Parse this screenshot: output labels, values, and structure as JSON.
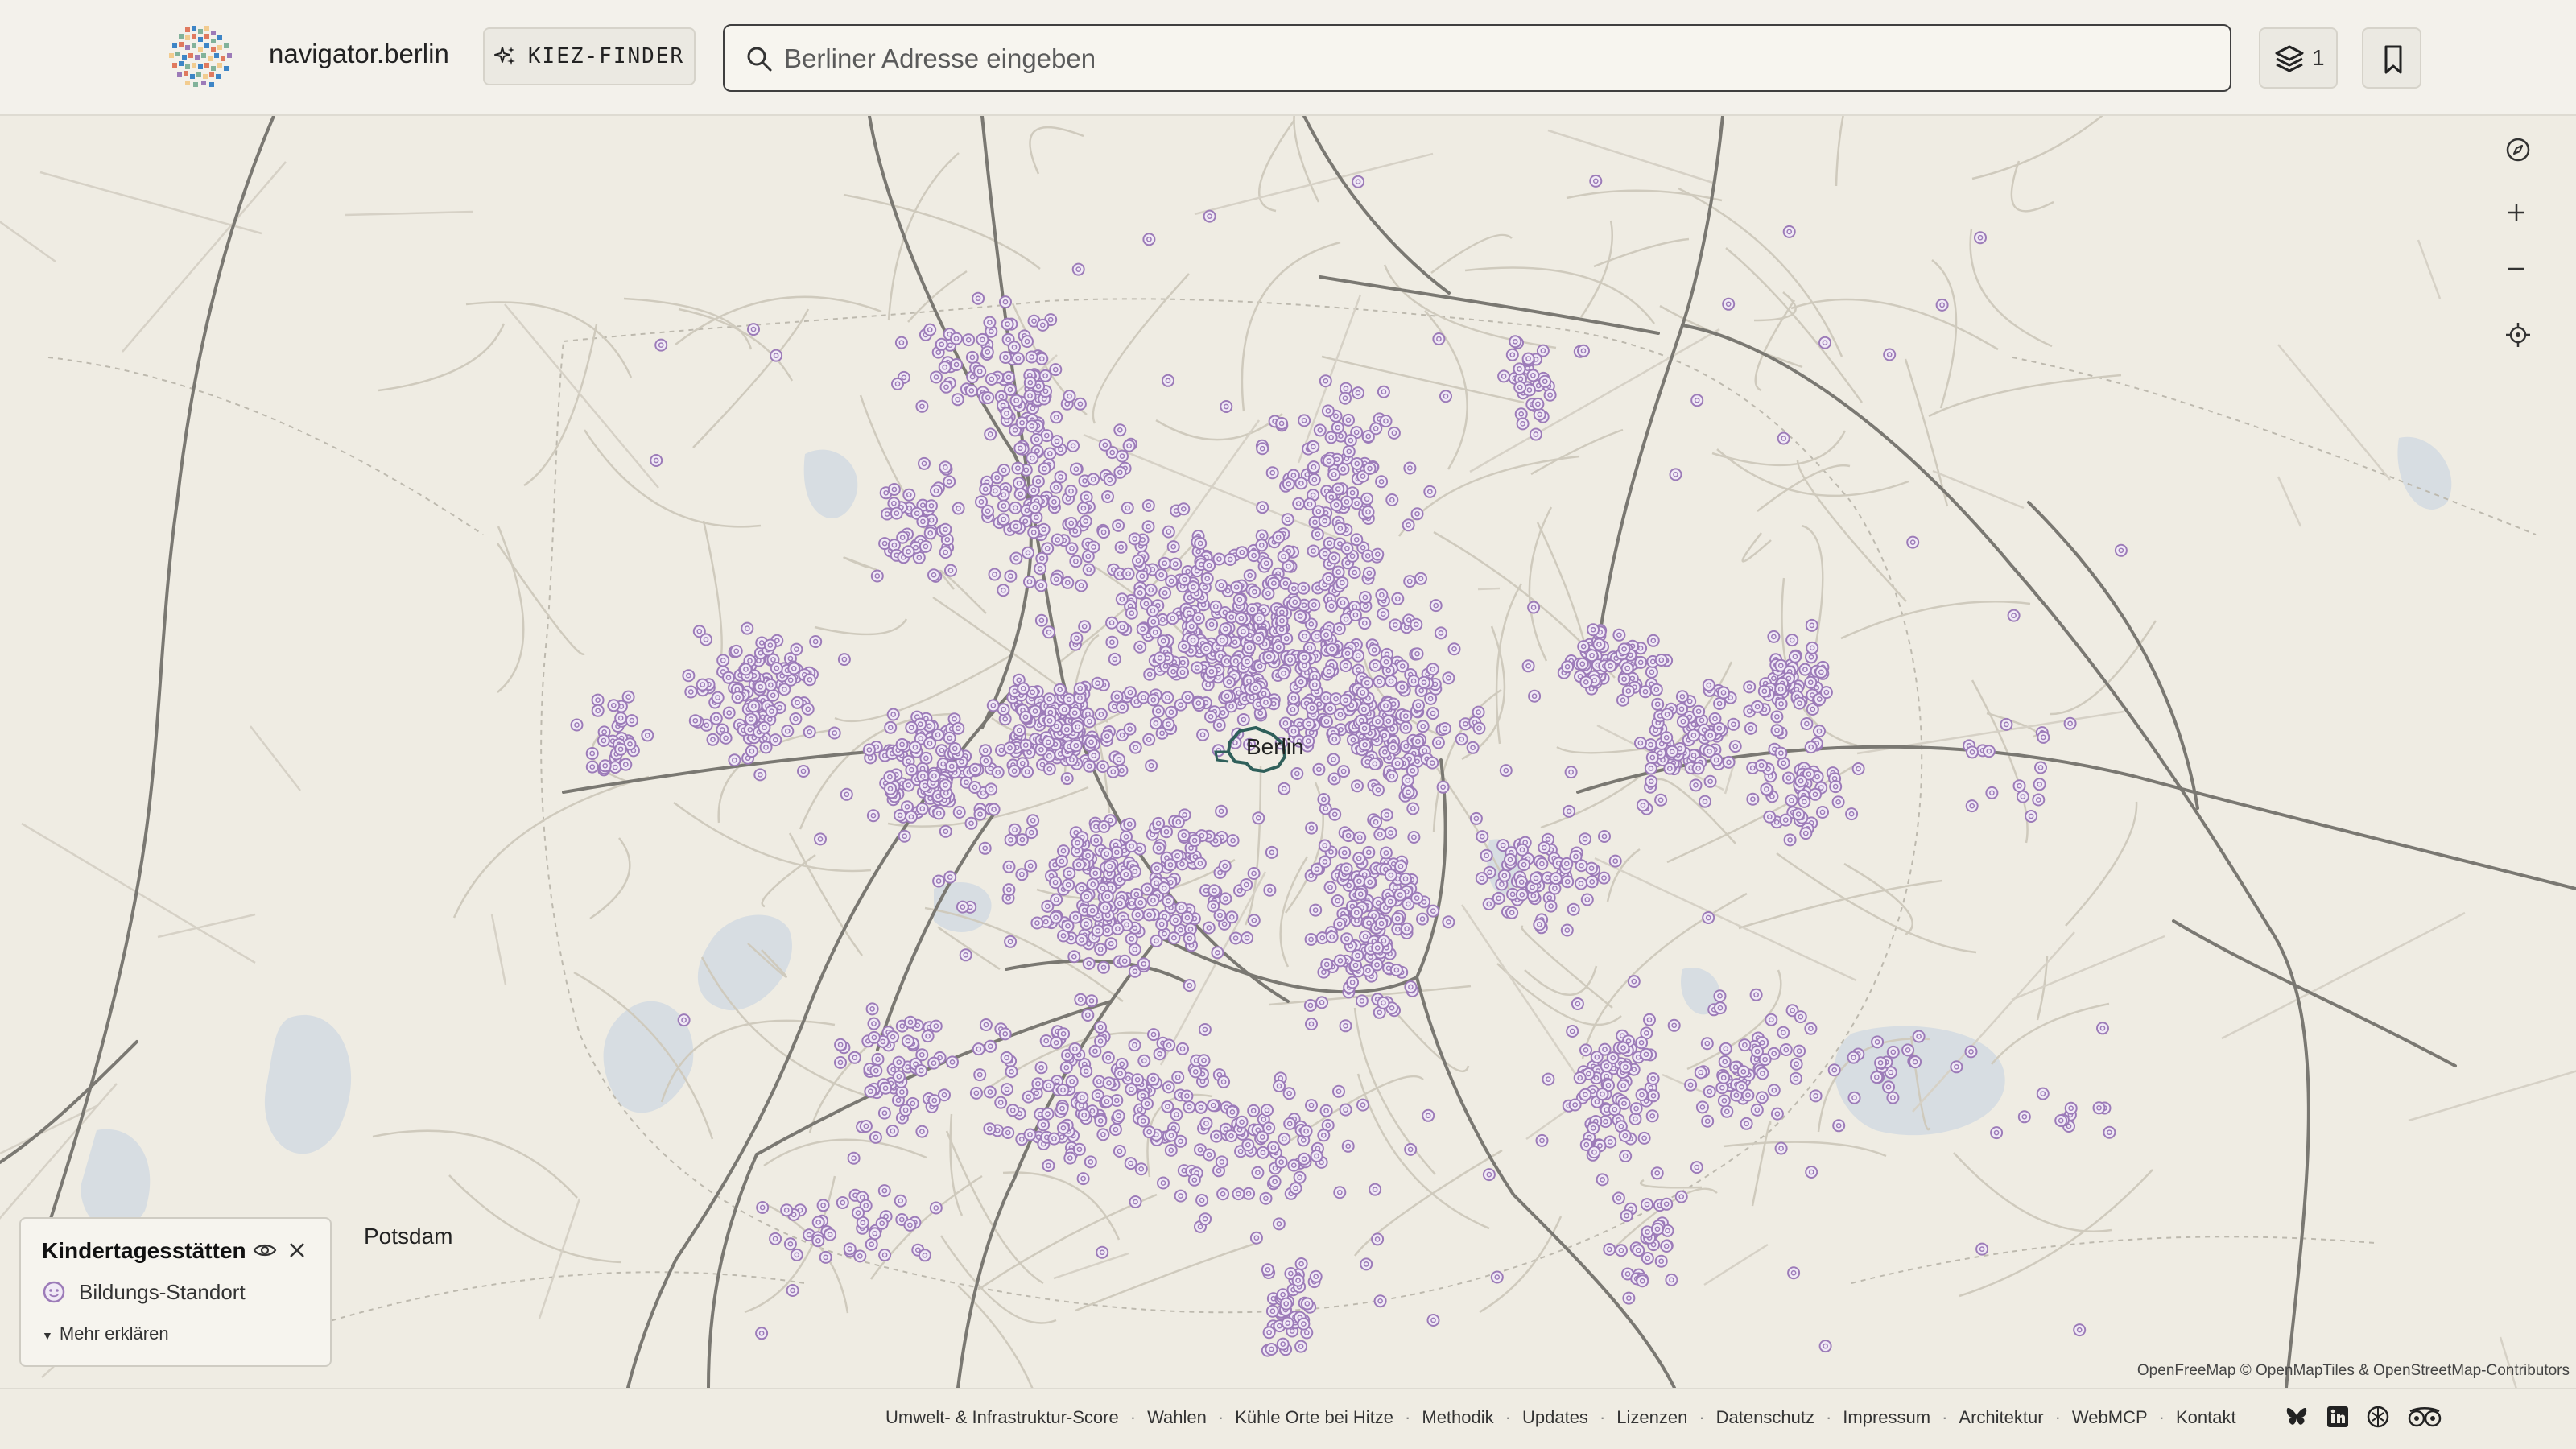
{
  "header": {
    "brand": "navigator.berlin",
    "kiez_button_label": "KIEZ-FINDER",
    "search_placeholder": "Berliner Adresse eingeben",
    "layers_count": "1"
  },
  "map": {
    "center_label": "Berlin",
    "potsdam_label": "Potsdam",
    "attribution": "OpenFreeMap © OpenMapTiles & OpenStreetMap-Contributors",
    "marker_color": "#9c7bb8",
    "controls": [
      "compass-icon",
      "zoom-in-icon",
      "zoom-out-icon",
      "locate-icon"
    ]
  },
  "legend": {
    "title": "Kindertagesstätten",
    "item_label": "Bildungs-Standort",
    "more_label": "Mehr erklären"
  },
  "footer": {
    "links": [
      "Umwelt- & Infrastruktur-Score",
      "Wahlen",
      "Kühle Orte bei Hitze",
      "Methodik",
      "Updates",
      "Lizenzen",
      "Datenschutz",
      "Impressum",
      "Architektur",
      "WebMCP",
      "Kontakt"
    ],
    "social_icons": [
      "bluesky-icon",
      "linkedin-icon",
      "github-icon",
      "tripadvisor-icon"
    ]
  }
}
